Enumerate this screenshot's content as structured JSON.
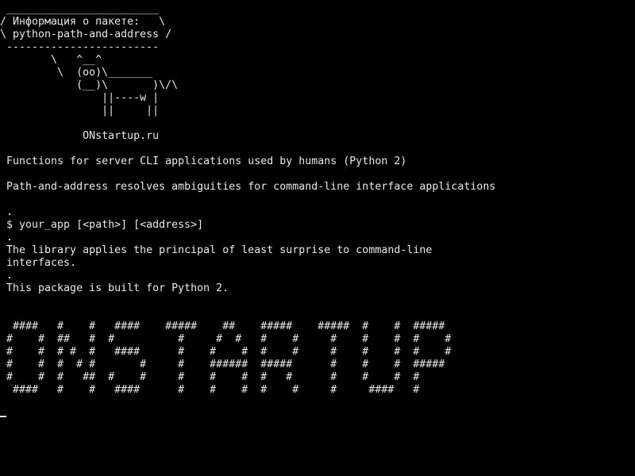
{
  "terminal": {
    "cowsay": [
      " ________________________",
      "/ Информация о пакете:   \\",
      "\\ python-path-and-address /",
      " ------------------------",
      "        \\   ^__^",
      "         \\  (oo)\\_______",
      "            (__)\\       )\\/\\",
      "                ||----w |",
      "                ||     ||"
    ],
    "site": "             ONstartup.ru",
    "description": [
      " Functions for server CLI applications used by humans (Python 2)",
      " Path-and-address resolves ambiguities for command-line interface applications",
      " .",
      " $ your_app [<path>] [<address>]",
      " .",
      " The library applies the principal of least surprise to command-line",
      " interfaces.",
      " .",
      " This package is built for Python 2."
    ],
    "banner": [
      "  ####   #    #   ####    #####    ##    #####    #####  #    #  #####",
      " #    #  ##   #  #          #     #  #   #    #     #    #    #  #    #",
      " #    #  # #  #   ####      #    #    #  #    #     #    #    #  #    #",
      " #    #  #  # #       #     #    ######  #####      #    #    #  #####",
      " #    #  #   ##  #    #     #    #    #  #   #      #    #    #  #",
      "  ####   #    #   ####      #    #    #  #    #     #     ####   #"
    ]
  }
}
